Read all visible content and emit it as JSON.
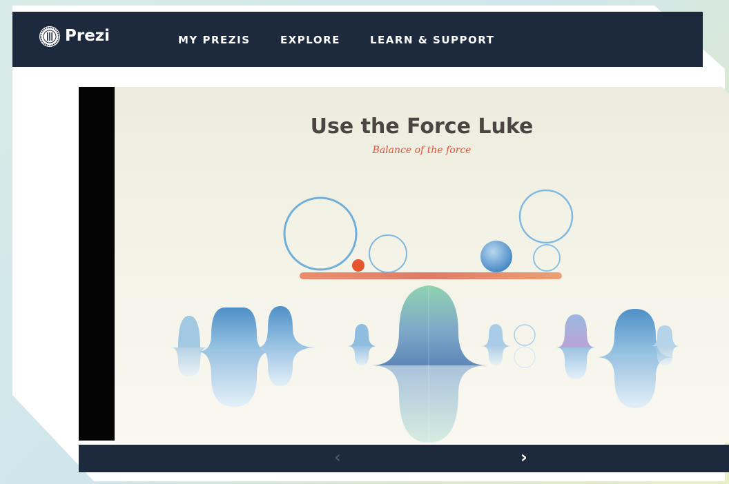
{
  "header": {
    "brand": "Prezi",
    "nav": [
      "MY PREZIS",
      "EXPLORE",
      "LEARN & SUPPORT"
    ]
  },
  "slide": {
    "title": "Use the Force Luke",
    "subtitle": "Balance of the force"
  },
  "controls": {
    "prev_label": "‹",
    "next_label": "›"
  },
  "colors": {
    "navbar": "#1d2a3e",
    "title": "#4c4443",
    "subtitle": "#e0533a",
    "accent_orange": "#e8825c",
    "bubble_blue": "#5a9ed0",
    "bell_green": "#8fd3b0"
  },
  "icons": {
    "logo": "prezi-logo-icon",
    "prev": "chevron-left-icon",
    "next": "chevron-right-icon"
  }
}
